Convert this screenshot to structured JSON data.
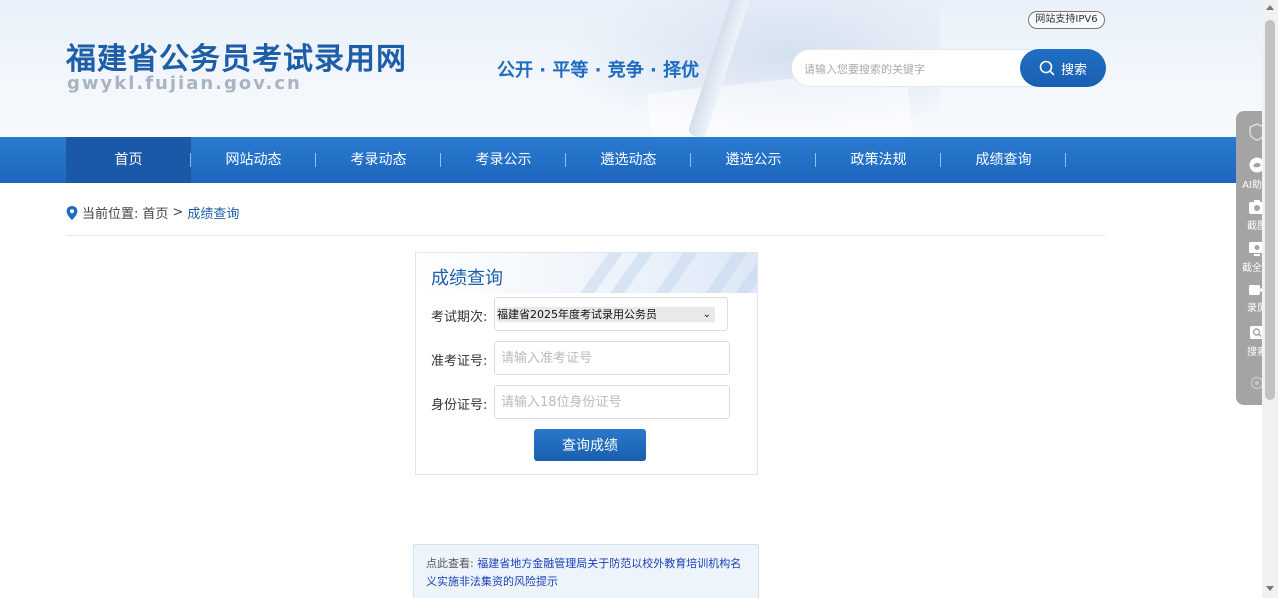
{
  "header": {
    "site_title": "福建省公务员考试录用网",
    "site_domain": "gwykl.fujian.gov.cn",
    "slogan": "公开 · 平等 · 竞争 · 择优",
    "ipv6_badge": "网站支持IPV6",
    "search": {
      "placeholder": "请输入您要搜索的关键字",
      "button_label": "搜索"
    }
  },
  "nav": {
    "items": [
      {
        "label": "首页",
        "active": true
      },
      {
        "label": "网站动态"
      },
      {
        "label": "考录动态"
      },
      {
        "label": "考录公示"
      },
      {
        "label": "遴选动态"
      },
      {
        "label": "遴选公示"
      },
      {
        "label": "政策法规"
      },
      {
        "label": "成绩查询"
      }
    ]
  },
  "breadcrumb": {
    "prefix": "当前位置:",
    "home": "首页",
    "separator": ">",
    "current": "成绩查询"
  },
  "query_panel": {
    "title": "成绩查询",
    "exam_period_label": "考试期次:",
    "exam_period_value": "福建省2025年度考试录用公务员",
    "ticket_label": "准考证号:",
    "ticket_placeholder": "请输入准考证号",
    "id_label": "身份证号:",
    "id_placeholder": "请输入18位身份证号",
    "submit_label": "查询成绩"
  },
  "notice": {
    "prefix": "点此查看:",
    "link_text": "福建省地方金融管理局关于防范以校外教育培训机构名义实施非法集资的风险提示"
  },
  "side_tools": {
    "items": [
      {
        "label": "",
        "icon": "shield-icon"
      },
      {
        "label": "AI助手",
        "icon": "ai-assistant-icon"
      },
      {
        "label": "截图",
        "icon": "camera-icon"
      },
      {
        "label": "截全屏",
        "icon": "screen-capture-icon"
      },
      {
        "label": "录屏",
        "icon": "video-icon"
      },
      {
        "label": "搜索",
        "icon": "search-icon"
      },
      {
        "label": "",
        "icon": "settings-icon"
      }
    ]
  }
}
